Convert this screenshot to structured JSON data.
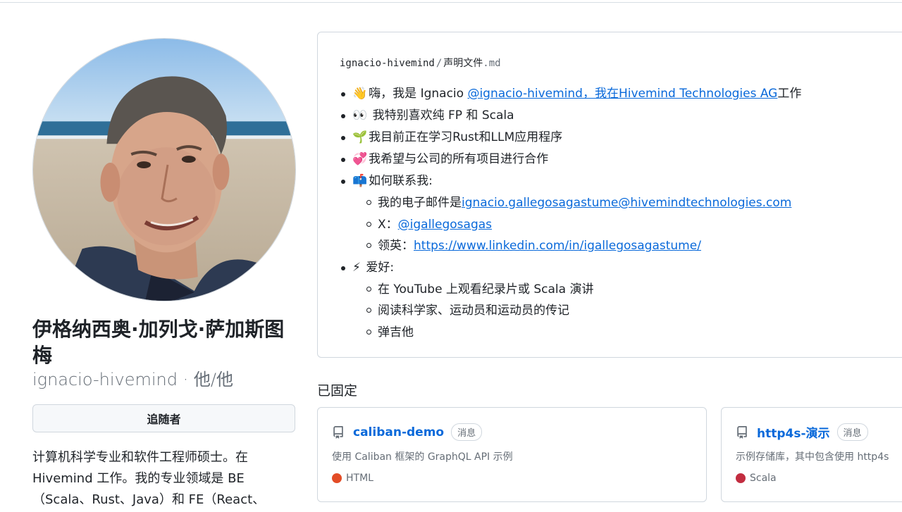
{
  "profile": {
    "full_name": "伊格纳西奥·加列戈·萨加斯图梅",
    "login": "ignacio-hivemind",
    "pronouns": "他/他",
    "separator": " · ",
    "follow_label": "追随者",
    "bio": "计算机科学专业和软件工程师硕士。在 Hivemind 工作。我的专业领域是 BE （Scala、Rust、Java）和 FE（React、"
  },
  "readme": {
    "path_user": "ignacio-hivemind",
    "path_sep": "/",
    "path_file": "声明文件",
    "path_ext": ".md",
    "items": [
      {
        "emoji": "👋",
        "text": "嗨，我是 Ignacio ",
        "link": "@ignacio-hivemind，我在Hivemind Technologies AG",
        "suffix": "工作"
      },
      {
        "emoji": "👀",
        "text": " 我特别喜欢纯 FP 和 Scala"
      },
      {
        "emoji": "🌱",
        "text": "我目前正在学习Rust和LLM应用程序"
      },
      {
        "emoji": "💞",
        "text": "我希望与公司的所有项目进行合作"
      },
      {
        "emoji": "📫",
        "text": "如何联系我:"
      },
      {
        "emoji": "⚡",
        "text": " 爱好:"
      }
    ],
    "contact": [
      {
        "text": "我的电子邮件是",
        "link": "ignacio.gallegosagastume@hivemindtechnologies.com"
      },
      {
        "text": "X：",
        "link": "@igallegosagas"
      },
      {
        "text": "领英：",
        "link": "https://www.linkedin.com/in/igallegosagastume/"
      }
    ],
    "hobbies": [
      "在 YouTube 上观看纪录片或 Scala 演讲",
      "阅读科学家、运动员和运动员的传记",
      "弹吉他"
    ]
  },
  "pinned": {
    "title": "已固定",
    "repos": [
      {
        "name": "caliban-demo",
        "badge": "消息",
        "description": "使用 Caliban 框架的 GraphQL API 示例",
        "language": "HTML",
        "lang_color": "#e34c26"
      },
      {
        "name": "http4s-演示",
        "badge": "消息",
        "description": "示例存储库，其中包含使用 http4s",
        "language": "Scala",
        "lang_color": "#c22d40"
      }
    ]
  },
  "icons": {
    "repo": "repo-icon"
  }
}
